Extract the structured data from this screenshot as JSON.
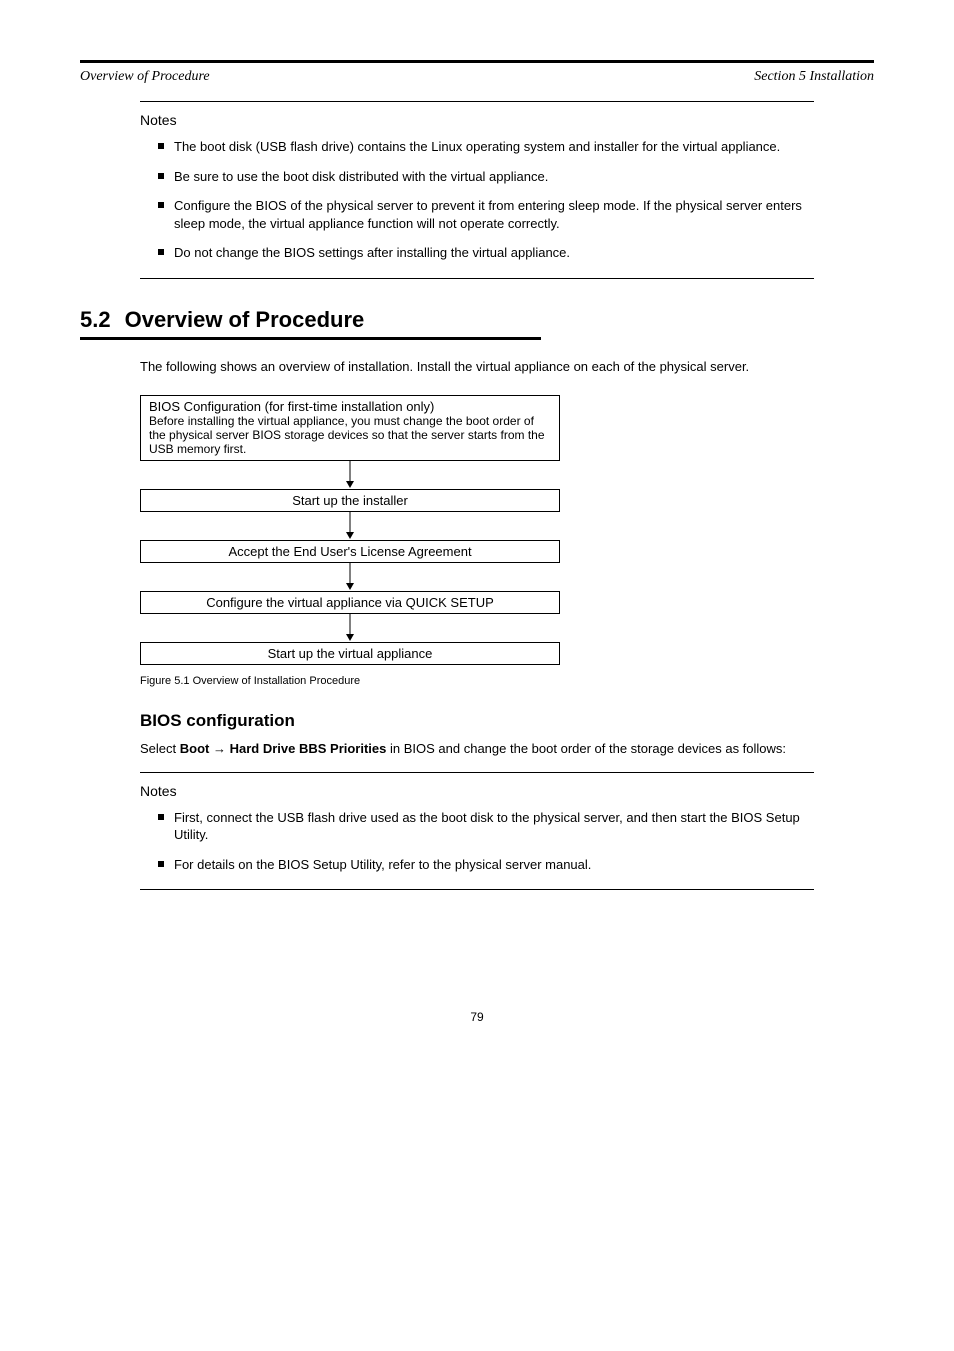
{
  "header": {
    "left": "Overview of Procedure",
    "right": "Section 5 Installation"
  },
  "notes": {
    "title": "Notes",
    "items": [
      "The boot disk (USB flash drive) contains the Linux operating system and installer for the virtual appliance.",
      "Be sure to use the boot disk distributed with the virtual appliance.",
      "Configure the BIOS of the physical server to prevent it from entering sleep mode. If the physical server enters sleep mode, the virtual appliance function will not operate correctly.",
      "Do not change the BIOS settings after installing the virtual appliance."
    ]
  },
  "section": {
    "num": "5.2",
    "title": "Overview of Procedure"
  },
  "overview_para": "The following shows an overview of installation. Install the virtual appliance on each of the physical server.",
  "flow": {
    "steps": [
      {
        "title": "BIOS Configuration (for first-time installation only)",
        "desc": "Before installing the virtual appliance, you must change the boot order of the physical server BIOS storage devices so that the server starts from the USB memory first."
      },
      {
        "title": "Start up the installer"
      },
      {
        "title": "Accept the End User's License Agreement"
      },
      {
        "title": "Configure the virtual appliance via QUICK SETUP"
      },
      {
        "title": "Start up the virtual appliance"
      }
    ]
  },
  "figure_caption": "Figure 5.1 Overview of Installation Procedure",
  "bios_heading": "BIOS configuration",
  "bios_instruction_prefix": "Select ",
  "bios_path1": "Boot",
  "bios_path2": "Hard Drive BBS Priorities",
  "bios_instruction_suffix": " in BIOS and change the boot order of the storage devices as follows:",
  "bios_notes": {
    "title": "Notes",
    "items": [
      "First, connect the USB flash drive used as the boot disk to the physical server, and then start the BIOS Setup Utility.",
      "For details on the BIOS Setup Utility, refer to the physical server manual."
    ]
  },
  "page_number": "79"
}
